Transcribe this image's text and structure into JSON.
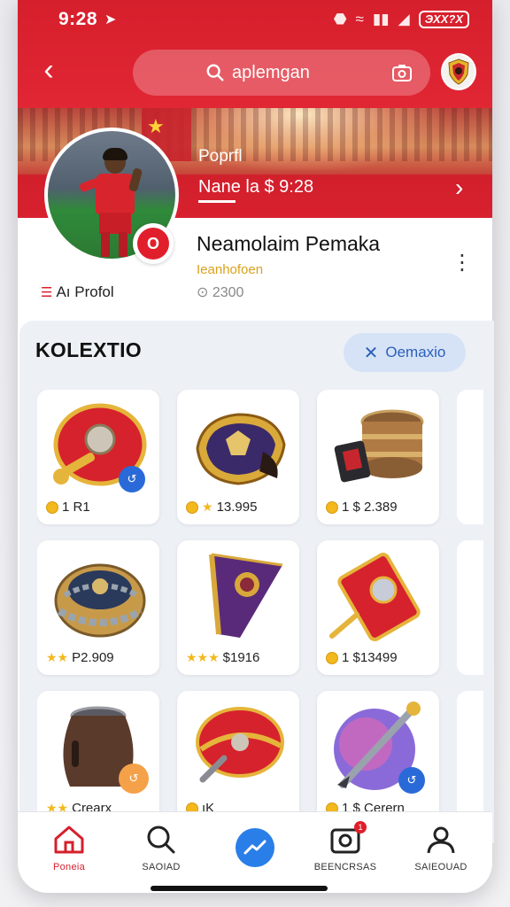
{
  "status_bar": {
    "time": "9:28",
    "battery": "ЭXX?X"
  },
  "header": {
    "search_placeholder": "aplemgan"
  },
  "banner": {
    "title": "Poprfl",
    "subtitle": "Nane la $ 9:28"
  },
  "profile": {
    "name": "Neamolaim Pemaka",
    "subtitle": "Ieanhofoen",
    "coins": "⊙ 2300",
    "link_label": "Aı Profol"
  },
  "collection": {
    "title": "KOLEXTIO",
    "filter_label": "Oemaxio",
    "items": [
      {
        "price": "1 R1",
        "marker": "coin"
      },
      {
        "price": "13.995",
        "marker": "coin-star"
      },
      {
        "price": "1 $ 2.389",
        "marker": "coin"
      },
      {
        "price": "P2.909",
        "marker": "stars"
      },
      {
        "price": "$1916",
        "marker": "stars3"
      },
      {
        "price": "1 $13499",
        "marker": "coin"
      },
      {
        "price": "Crearx",
        "marker": "stars"
      },
      {
        "price": "ıK",
        "marker": "coin"
      },
      {
        "price": "1 $ Cerern",
        "marker": "coin"
      }
    ]
  },
  "bottom_nav": {
    "items": [
      {
        "label": "Poneia"
      },
      {
        "label": "SAOIAD"
      },
      {
        "label": "BEENCRSAS"
      },
      {
        "label": "SAIEOUAD"
      }
    ],
    "notif_count": "1"
  },
  "colors": {
    "brand": "#d61f2c",
    "accent": "#2a7ee8",
    "gold": "#f2b81c"
  }
}
